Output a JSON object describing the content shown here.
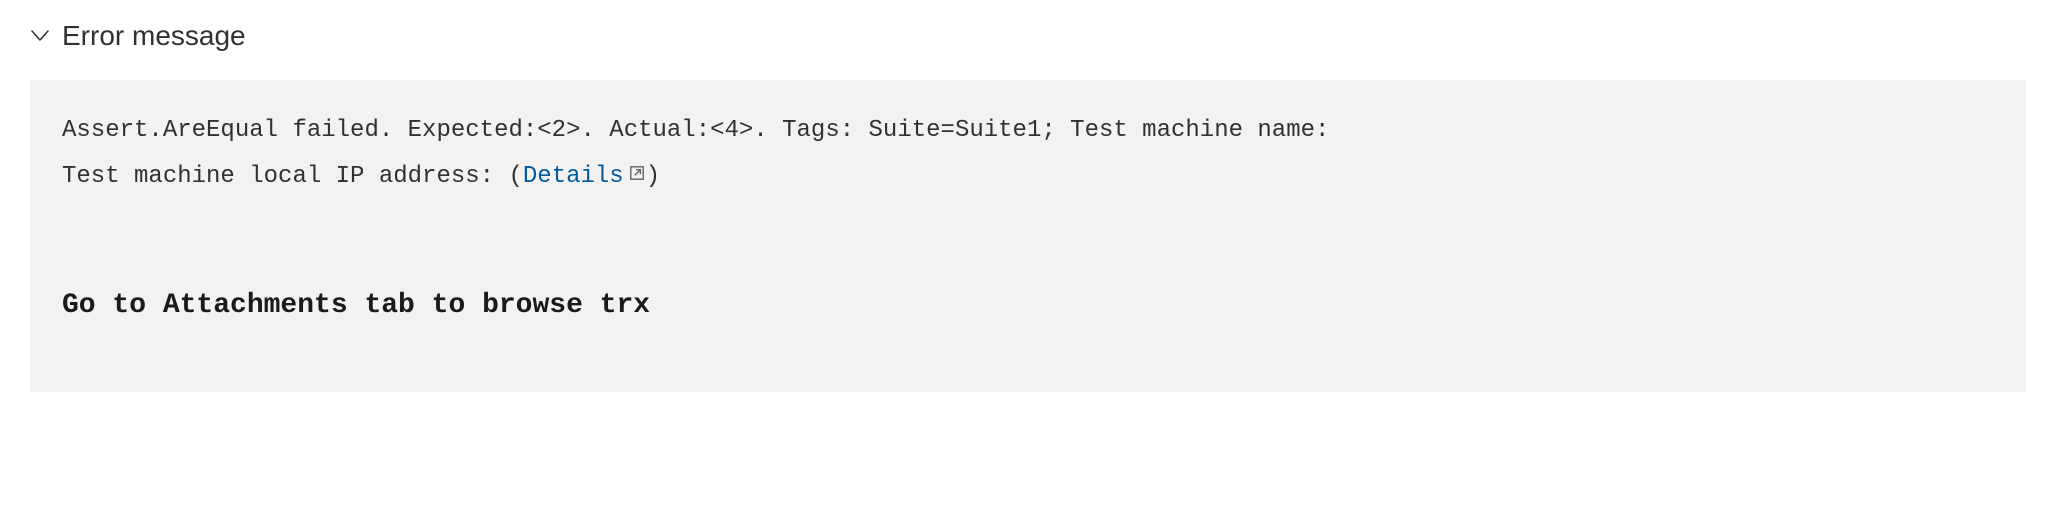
{
  "section": {
    "title": "Error message"
  },
  "error": {
    "line1_prefix": "Assert.AreEqual failed. Expected:<2>. Actual:<4>. Tags: Suite=Suite1; Test machine name:",
    "line2_prefix": "Test machine local IP address:           ",
    "details_open": "(",
    "details_label": "Details",
    "details_close": ")"
  },
  "attachments_note": "Go to Attachments tab to browse trx"
}
